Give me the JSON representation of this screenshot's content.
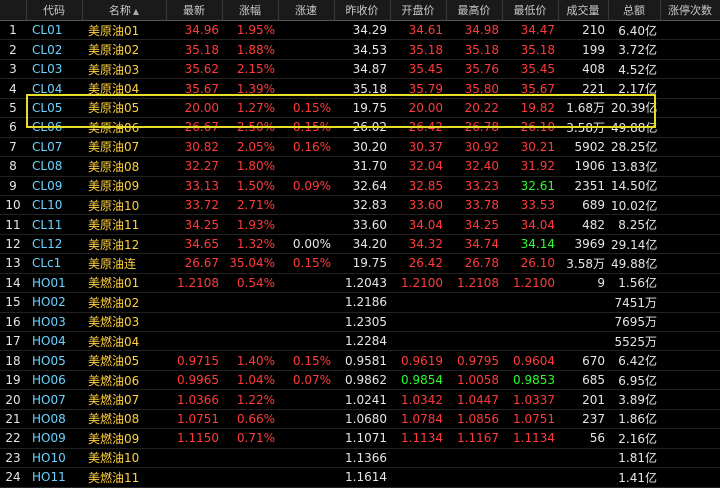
{
  "table": {
    "headers": [
      "",
      "代码",
      "名称",
      "最新",
      "涨幅",
      "涨速",
      "昨收价",
      "开盘价",
      "最高价",
      "最低价",
      "成交量",
      "总额",
      "涨停次数"
    ],
    "sort_icon": "▲",
    "rows": [
      {
        "idx": "1",
        "code": "CL01",
        "name": "美原油01",
        "last": "34.96",
        "chg": "1.95%",
        "speed": "",
        "prev": "34.29",
        "open": "34.61",
        "high": "34.98",
        "low": "34.47",
        "vol": "210",
        "amt": "6.40亿",
        "limit": "",
        "c": {
          "last": "up",
          "chg": "up",
          "speed": "up",
          "open": "up",
          "high": "up",
          "low": "up"
        }
      },
      {
        "idx": "2",
        "code": "CL02",
        "name": "美原油02",
        "last": "35.18",
        "chg": "1.88%",
        "speed": "",
        "prev": "34.53",
        "open": "35.18",
        "high": "35.18",
        "low": "35.18",
        "vol": "199",
        "amt": "3.72亿",
        "limit": "",
        "c": {
          "last": "up",
          "chg": "up",
          "speed": "up",
          "open": "up",
          "high": "up",
          "low": "up"
        }
      },
      {
        "idx": "3",
        "code": "CL03",
        "name": "美原油03",
        "last": "35.62",
        "chg": "2.15%",
        "speed": "",
        "prev": "34.87",
        "open": "35.45",
        "high": "35.76",
        "low": "35.45",
        "vol": "408",
        "amt": "4.52亿",
        "limit": "",
        "c": {
          "last": "up",
          "chg": "up",
          "speed": "up",
          "open": "up",
          "high": "up",
          "low": "up"
        }
      },
      {
        "idx": "4",
        "code": "CL04",
        "name": "美原油04",
        "last": "35.67",
        "chg": "1.39%",
        "speed": "",
        "prev": "35.18",
        "open": "35.79",
        "high": "35.80",
        "low": "35.67",
        "vol": "221",
        "amt": "2.17亿",
        "limit": "",
        "c": {
          "last": "up",
          "chg": "up",
          "speed": "up",
          "open": "up",
          "high": "up",
          "low": "up"
        }
      },
      {
        "idx": "5",
        "code": "CL05",
        "name": "美原油05",
        "last": "20.00",
        "chg": "1.27%",
        "speed": "0.15%",
        "prev": "19.75",
        "open": "20.00",
        "high": "20.22",
        "low": "19.82",
        "vol": "1.68万",
        "amt": "20.39亿",
        "limit": "",
        "c": {
          "last": "up",
          "chg": "up",
          "speed": "up",
          "open": "up",
          "high": "up",
          "low": "up"
        }
      },
      {
        "idx": "6",
        "code": "CL06",
        "name": "美原油06",
        "last": "26.67",
        "chg": "2.50%",
        "speed": "0.15%",
        "prev": "26.02",
        "open": "26.42",
        "high": "26.78",
        "low": "26.10",
        "vol": "3.58万",
        "amt": "49.88亿",
        "limit": "",
        "c": {
          "last": "up",
          "chg": "up",
          "speed": "up",
          "open": "up",
          "high": "up",
          "low": "up"
        }
      },
      {
        "idx": "7",
        "code": "CL07",
        "name": "美原油07",
        "last": "30.82",
        "chg": "2.05%",
        "speed": "0.16%",
        "prev": "30.20",
        "open": "30.37",
        "high": "30.92",
        "low": "30.21",
        "vol": "5902",
        "amt": "28.25亿",
        "limit": "",
        "c": {
          "last": "up",
          "chg": "up",
          "speed": "up",
          "open": "up",
          "high": "up",
          "low": "up"
        }
      },
      {
        "idx": "8",
        "code": "CL08",
        "name": "美原油08",
        "last": "32.27",
        "chg": "1.80%",
        "speed": "",
        "prev": "31.70",
        "open": "32.04",
        "high": "32.40",
        "low": "31.92",
        "vol": "1906",
        "amt": "13.83亿",
        "limit": "",
        "c": {
          "last": "up",
          "chg": "up",
          "speed": "up",
          "open": "up",
          "high": "up",
          "low": "up"
        }
      },
      {
        "idx": "9",
        "code": "CL09",
        "name": "美原油09",
        "last": "33.13",
        "chg": "1.50%",
        "speed": "0.09%",
        "prev": "32.64",
        "open": "32.85",
        "high": "33.23",
        "low": "32.61",
        "vol": "2351",
        "amt": "14.50亿",
        "limit": "",
        "c": {
          "last": "up",
          "chg": "up",
          "speed": "up",
          "open": "up",
          "high": "up",
          "low": "dn"
        }
      },
      {
        "idx": "10",
        "code": "CL10",
        "name": "美原油10",
        "last": "33.72",
        "chg": "2.71%",
        "speed": "",
        "prev": "32.83",
        "open": "33.60",
        "high": "33.78",
        "low": "33.53",
        "vol": "689",
        "amt": "10.02亿",
        "limit": "",
        "c": {
          "last": "up",
          "chg": "up",
          "speed": "up",
          "open": "up",
          "high": "up",
          "low": "up"
        }
      },
      {
        "idx": "11",
        "code": "CL11",
        "name": "美原油11",
        "last": "34.25",
        "chg": "1.93%",
        "speed": "",
        "prev": "33.60",
        "open": "34.04",
        "high": "34.25",
        "low": "34.04",
        "vol": "482",
        "amt": "8.25亿",
        "limit": "",
        "c": {
          "last": "up",
          "chg": "up",
          "speed": "up",
          "open": "up",
          "high": "up",
          "low": "up"
        }
      },
      {
        "idx": "12",
        "code": "CL12",
        "name": "美原油12",
        "last": "34.65",
        "chg": "1.32%",
        "speed": "0.00%",
        "prev": "34.20",
        "open": "34.32",
        "high": "34.74",
        "low": "34.14",
        "vol": "3969",
        "amt": "29.14亿",
        "limit": "",
        "c": {
          "last": "up",
          "chg": "up",
          "speed": "wh",
          "open": "up",
          "high": "up",
          "low": "dn"
        }
      },
      {
        "idx": "13",
        "code": "CLc1",
        "name": "美原油连",
        "last": "26.67",
        "chg": "35.04%",
        "speed": "0.15%",
        "prev": "19.75",
        "open": "26.42",
        "high": "26.78",
        "low": "26.10",
        "vol": "3.58万",
        "amt": "49.88亿",
        "limit": "",
        "c": {
          "last": "up",
          "chg": "up",
          "speed": "up",
          "open": "up",
          "high": "up",
          "low": "up"
        }
      },
      {
        "idx": "14",
        "code": "HO01",
        "name": "美燃油01",
        "last": "1.2108",
        "chg": "0.54%",
        "speed": "",
        "prev": "1.2043",
        "open": "1.2100",
        "high": "1.2108",
        "low": "1.2100",
        "vol": "9",
        "amt": "1.56亿",
        "limit": "",
        "c": {
          "last": "up",
          "chg": "up",
          "speed": "up",
          "open": "up",
          "high": "up",
          "low": "up"
        }
      },
      {
        "idx": "15",
        "code": "HO02",
        "name": "美燃油02",
        "last": "",
        "chg": "",
        "speed": "",
        "prev": "1.2186",
        "open": "",
        "high": "",
        "low": "",
        "vol": "",
        "amt": "7451万",
        "limit": "",
        "c": {}
      },
      {
        "idx": "16",
        "code": "HO03",
        "name": "美燃油03",
        "last": "",
        "chg": "",
        "speed": "",
        "prev": "1.2305",
        "open": "",
        "high": "",
        "low": "",
        "vol": "",
        "amt": "7695万",
        "limit": "",
        "c": {}
      },
      {
        "idx": "17",
        "code": "HO04",
        "name": "美燃油04",
        "last": "",
        "chg": "",
        "speed": "",
        "prev": "1.2284",
        "open": "",
        "high": "",
        "low": "",
        "vol": "",
        "amt": "5525万",
        "limit": "",
        "c": {}
      },
      {
        "idx": "18",
        "code": "HO05",
        "name": "美燃油05",
        "last": "0.9715",
        "chg": "1.40%",
        "speed": "0.15%",
        "prev": "0.9581",
        "open": "0.9619",
        "high": "0.9795",
        "low": "0.9604",
        "vol": "670",
        "amt": "6.42亿",
        "limit": "",
        "c": {
          "last": "up",
          "chg": "up",
          "speed": "up",
          "open": "up",
          "high": "up",
          "low": "up"
        }
      },
      {
        "idx": "19",
        "code": "HO06",
        "name": "美燃油06",
        "last": "0.9965",
        "chg": "1.04%",
        "speed": "0.07%",
        "prev": "0.9862",
        "open": "0.9854",
        "high": "1.0058",
        "low": "0.9853",
        "vol": "685",
        "amt": "6.95亿",
        "limit": "",
        "c": {
          "last": "up",
          "chg": "up",
          "speed": "up",
          "open": "dn",
          "high": "up",
          "low": "dn"
        }
      },
      {
        "idx": "20",
        "code": "HO07",
        "name": "美燃油07",
        "last": "1.0366",
        "chg": "1.22%",
        "speed": "",
        "prev": "1.0241",
        "open": "1.0342",
        "high": "1.0447",
        "low": "1.0337",
        "vol": "201",
        "amt": "3.89亿",
        "limit": "",
        "c": {
          "last": "up",
          "chg": "up",
          "speed": "up",
          "open": "up",
          "high": "up",
          "low": "up"
        }
      },
      {
        "idx": "21",
        "code": "HO08",
        "name": "美燃油08",
        "last": "1.0751",
        "chg": "0.66%",
        "speed": "",
        "prev": "1.0680",
        "open": "1.0784",
        "high": "1.0856",
        "low": "1.0751",
        "vol": "237",
        "amt": "1.86亿",
        "limit": "",
        "c": {
          "last": "up",
          "chg": "up",
          "speed": "up",
          "open": "up",
          "high": "up",
          "low": "up"
        }
      },
      {
        "idx": "22",
        "code": "HO09",
        "name": "美燃油09",
        "last": "1.1150",
        "chg": "0.71%",
        "speed": "",
        "prev": "1.1071",
        "open": "1.1134",
        "high": "1.1167",
        "low": "1.1134",
        "vol": "56",
        "amt": "2.16亿",
        "limit": "",
        "c": {
          "last": "up",
          "chg": "up",
          "speed": "up",
          "open": "up",
          "high": "up",
          "low": "up"
        }
      },
      {
        "idx": "23",
        "code": "HO10",
        "name": "美燃油10",
        "last": "",
        "chg": "",
        "speed": "",
        "prev": "1.1366",
        "open": "",
        "high": "",
        "low": "",
        "vol": "",
        "amt": "1.81亿",
        "limit": "",
        "c": {}
      },
      {
        "idx": "24",
        "code": "HO11",
        "name": "美燃油11",
        "last": "",
        "chg": "",
        "speed": "",
        "prev": "1.1614",
        "open": "",
        "high": "",
        "low": "",
        "vol": "",
        "amt": "1.41亿",
        "limit": "",
        "c": {}
      }
    ]
  },
  "colors": {
    "up": "#ff3b3b",
    "down": "#2bff2b",
    "code": "#6ad3ff",
    "name": "#ffd23f",
    "highlight_box": "#e6dc2a"
  }
}
